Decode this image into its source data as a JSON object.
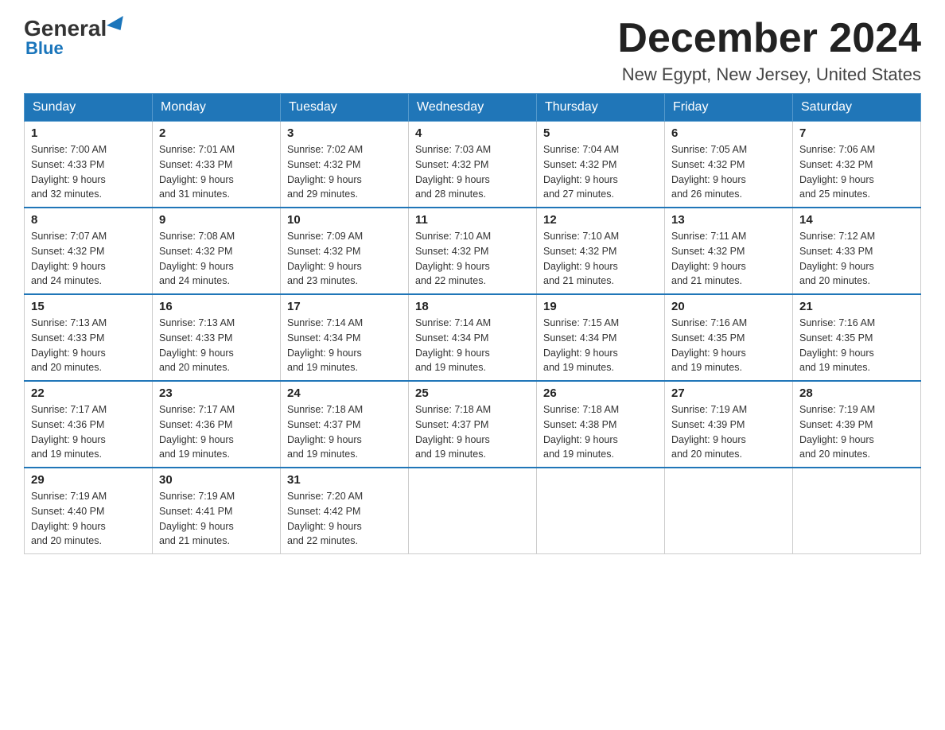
{
  "logo": {
    "text_general": "General",
    "text_blue": "Blue"
  },
  "title": "December 2024",
  "location": "New Egypt, New Jersey, United States",
  "days_of_week": [
    "Sunday",
    "Monday",
    "Tuesday",
    "Wednesday",
    "Thursday",
    "Friday",
    "Saturday"
  ],
  "weeks": [
    [
      {
        "day": "1",
        "sunrise": "7:00 AM",
        "sunset": "4:33 PM",
        "daylight": "9 hours and 32 minutes."
      },
      {
        "day": "2",
        "sunrise": "7:01 AM",
        "sunset": "4:33 PM",
        "daylight": "9 hours and 31 minutes."
      },
      {
        "day": "3",
        "sunrise": "7:02 AM",
        "sunset": "4:32 PM",
        "daylight": "9 hours and 29 minutes."
      },
      {
        "day": "4",
        "sunrise": "7:03 AM",
        "sunset": "4:32 PM",
        "daylight": "9 hours and 28 minutes."
      },
      {
        "day": "5",
        "sunrise": "7:04 AM",
        "sunset": "4:32 PM",
        "daylight": "9 hours and 27 minutes."
      },
      {
        "day": "6",
        "sunrise": "7:05 AM",
        "sunset": "4:32 PM",
        "daylight": "9 hours and 26 minutes."
      },
      {
        "day": "7",
        "sunrise": "7:06 AM",
        "sunset": "4:32 PM",
        "daylight": "9 hours and 25 minutes."
      }
    ],
    [
      {
        "day": "8",
        "sunrise": "7:07 AM",
        "sunset": "4:32 PM",
        "daylight": "9 hours and 24 minutes."
      },
      {
        "day": "9",
        "sunrise": "7:08 AM",
        "sunset": "4:32 PM",
        "daylight": "9 hours and 24 minutes."
      },
      {
        "day": "10",
        "sunrise": "7:09 AM",
        "sunset": "4:32 PM",
        "daylight": "9 hours and 23 minutes."
      },
      {
        "day": "11",
        "sunrise": "7:10 AM",
        "sunset": "4:32 PM",
        "daylight": "9 hours and 22 minutes."
      },
      {
        "day": "12",
        "sunrise": "7:10 AM",
        "sunset": "4:32 PM",
        "daylight": "9 hours and 21 minutes."
      },
      {
        "day": "13",
        "sunrise": "7:11 AM",
        "sunset": "4:32 PM",
        "daylight": "9 hours and 21 minutes."
      },
      {
        "day": "14",
        "sunrise": "7:12 AM",
        "sunset": "4:33 PM",
        "daylight": "9 hours and 20 minutes."
      }
    ],
    [
      {
        "day": "15",
        "sunrise": "7:13 AM",
        "sunset": "4:33 PM",
        "daylight": "9 hours and 20 minutes."
      },
      {
        "day": "16",
        "sunrise": "7:13 AM",
        "sunset": "4:33 PM",
        "daylight": "9 hours and 20 minutes."
      },
      {
        "day": "17",
        "sunrise": "7:14 AM",
        "sunset": "4:34 PM",
        "daylight": "9 hours and 19 minutes."
      },
      {
        "day": "18",
        "sunrise": "7:14 AM",
        "sunset": "4:34 PM",
        "daylight": "9 hours and 19 minutes."
      },
      {
        "day": "19",
        "sunrise": "7:15 AM",
        "sunset": "4:34 PM",
        "daylight": "9 hours and 19 minutes."
      },
      {
        "day": "20",
        "sunrise": "7:16 AM",
        "sunset": "4:35 PM",
        "daylight": "9 hours and 19 minutes."
      },
      {
        "day": "21",
        "sunrise": "7:16 AM",
        "sunset": "4:35 PM",
        "daylight": "9 hours and 19 minutes."
      }
    ],
    [
      {
        "day": "22",
        "sunrise": "7:17 AM",
        "sunset": "4:36 PM",
        "daylight": "9 hours and 19 minutes."
      },
      {
        "day": "23",
        "sunrise": "7:17 AM",
        "sunset": "4:36 PM",
        "daylight": "9 hours and 19 minutes."
      },
      {
        "day": "24",
        "sunrise": "7:18 AM",
        "sunset": "4:37 PM",
        "daylight": "9 hours and 19 minutes."
      },
      {
        "day": "25",
        "sunrise": "7:18 AM",
        "sunset": "4:37 PM",
        "daylight": "9 hours and 19 minutes."
      },
      {
        "day": "26",
        "sunrise": "7:18 AM",
        "sunset": "4:38 PM",
        "daylight": "9 hours and 19 minutes."
      },
      {
        "day": "27",
        "sunrise": "7:19 AM",
        "sunset": "4:39 PM",
        "daylight": "9 hours and 20 minutes."
      },
      {
        "day": "28",
        "sunrise": "7:19 AM",
        "sunset": "4:39 PM",
        "daylight": "9 hours and 20 minutes."
      }
    ],
    [
      {
        "day": "29",
        "sunrise": "7:19 AM",
        "sunset": "4:40 PM",
        "daylight": "9 hours and 20 minutes."
      },
      {
        "day": "30",
        "sunrise": "7:19 AM",
        "sunset": "4:41 PM",
        "daylight": "9 hours and 21 minutes."
      },
      {
        "day": "31",
        "sunrise": "7:20 AM",
        "sunset": "4:42 PM",
        "daylight": "9 hours and 22 minutes."
      },
      null,
      null,
      null,
      null
    ]
  ],
  "labels": {
    "sunrise": "Sunrise:",
    "sunset": "Sunset:",
    "daylight": "Daylight:"
  }
}
